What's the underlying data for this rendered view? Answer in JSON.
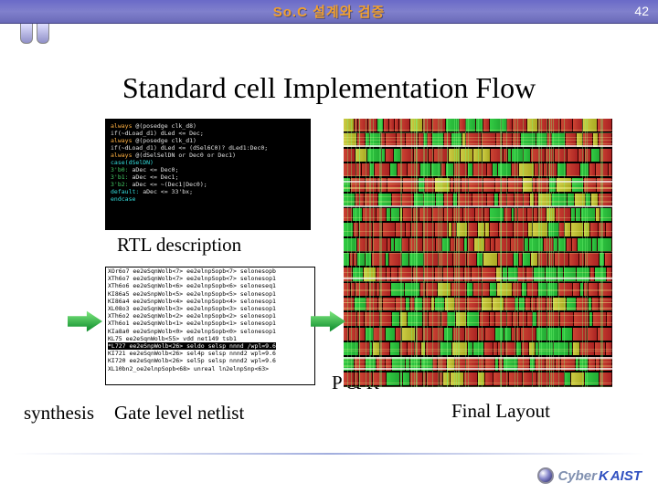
{
  "header": {
    "title": "So.C  설계와  검증",
    "page": "42"
  },
  "slide": {
    "title": "Standard cell Implementation Flow"
  },
  "labels": {
    "rtl": "RTL description",
    "synthesis": "synthesis",
    "gate": "Gate level netlist",
    "pr": "P & R",
    "final": "Final Layout"
  },
  "rtl_code": [
    {
      "c": "kw",
      "t": "always "
    },
    {
      "c": "wh",
      "t": "@(posedge clk_d8)"
    },
    null,
    {
      "c": "wh",
      "t": "   if(~dLoad_d1) dLed <= Dec;"
    },
    null,
    null,
    {
      "c": "kw",
      "t": "always "
    },
    {
      "c": "wh",
      "t": "@(posedge clk_d1)"
    },
    null,
    {
      "c": "wh",
      "t": "   if(~dLoad_d1) dLed <= (dSel6C0)? dLed1:Dec0;"
    },
    null,
    null,
    {
      "c": "kw",
      "t": "always "
    },
    {
      "c": "wh",
      "t": "@(dSelSelDN or Dec0 or Dec1)"
    },
    null,
    {
      "c": "cy",
      "t": "   case(dSelDN)"
    },
    null,
    {
      "c": "gr",
      "t": "     3'b0:"
    },
    {
      "c": "wh",
      "t": "   aDec <= Dec0;"
    },
    null,
    {
      "c": "gr",
      "t": "     3'b1:"
    },
    {
      "c": "wh",
      "t": "   aDec <= Dec1;"
    },
    null,
    {
      "c": "gr",
      "t": "     3'b2:"
    },
    {
      "c": "wh",
      "t": "   aDec <= ~(Dec1|Dec0);"
    },
    null,
    {
      "c": "cy",
      "t": "     default:"
    },
    {
      "c": "wh",
      "t": " aDec <= 33'bx;"
    },
    null,
    {
      "c": "cy",
      "t": "   endcase"
    },
    null
  ],
  "netlist": [
    "XOr6o7 ee2eSqnWolb<7> ee2elnpSopb<7> selonesopb",
    "XTh6o7 ee2eSqnWolb<7> ee2elnpSopb<7> selonesop1",
    "XTh6o6 ee2eSqnWolb<6> ee2elnpSopb<6> seloneseq1",
    "KI86a5 ee2eSnpWolb<5> ee2elnpSopb<5> selonesop1",
    "KI86a4 ee2eSnpWolb<4> ee2elnpSopb<4> selonesop1",
    "XL08o3 ee2eSqnWolb<3> ee2elnpSopb<3> selonesop1",
    "XTh6o2 ee2eSqnWolb<2> ee2elnpSopb<2> selonesop1",
    "XTh6o1 ee2eSqnWolb<1> ee2elnpSopb<1> selonesop1",
    "KIa8a0 ee2eSnpWolb<0> ee2elnpSopb<0> selonesop1",
    "KL75 ee2eSqnWolb<55> vdd net149 tsb1",
    "*L727 ee2eSnpWolb<26> seldo selsp nnnd /wpl=9.6",
    "KI721 ee2eSqnWolb<26> sel4p selsp nnnd2 wpl=9.6",
    "KI720 ee2eSqnWolb<26> sel5p selsp nnnd2 wpl=9.6",
    "XL10bn2_oe2elnpSopb<68> unreal ln2elnpSnp<63>"
  ],
  "logo": {
    "prefix": "Cyber",
    "suffix1": "K",
    "suffix2": "AIST"
  }
}
